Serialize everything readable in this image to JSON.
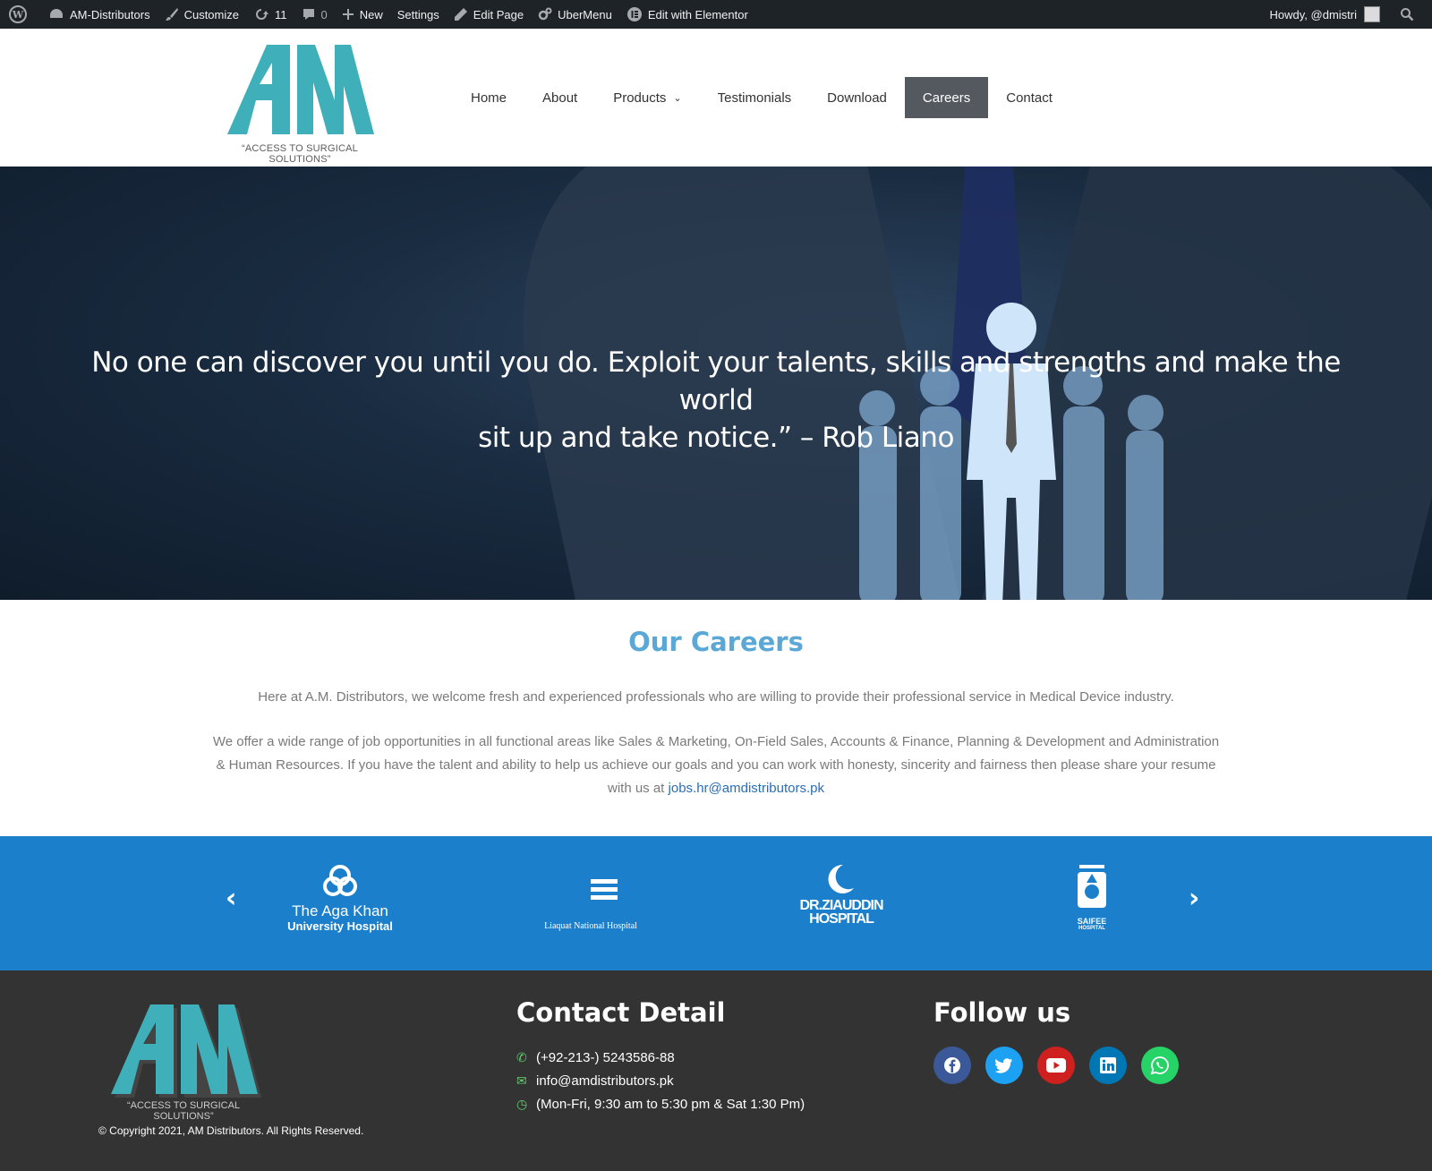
{
  "admin_bar": {
    "site_name": "AM-Distributors",
    "customize": "Customize",
    "updates_count": "11",
    "comments_count": "0",
    "new_label": "New",
    "settings": "Settings",
    "edit_page": "Edit Page",
    "ubermenu": "UberMenu",
    "edit_elementor": "Edit with Elementor",
    "howdy": "Howdy, @dmistri"
  },
  "header": {
    "logo_text": "AM",
    "logo_tagline": "“ACCESS TO SURGICAL SOLUTIONS”",
    "nav": [
      {
        "label": "Home"
      },
      {
        "label": "About"
      },
      {
        "label": "Products"
      },
      {
        "label": "Testimonials"
      },
      {
        "label": "Download"
      },
      {
        "label": "Careers"
      },
      {
        "label": "Contact"
      }
    ],
    "active_nav": "Careers"
  },
  "hero": {
    "quote_line1": "No one can discover you until you do. Exploit your talents, skills and strengths and make the world",
    "quote_line2": "sit up and take notice.” – Rob Liano"
  },
  "careers": {
    "title": "Our Careers",
    "paragraph1": "Here at A.M. Distributors, we welcome fresh and experienced professionals who are willing to provide their professional service in Medical Device industry.",
    "paragraph2": "We offer a wide range of job opportunities in all functional areas like Sales & Marketing, On-Field Sales, Accounts & Finance, Planning & Development and Administration & Human Resources. If you have the talent and ability to help us achieve our goals and you can work with honesty, sincerity and fairness then please share your resume with us at",
    "email": "jobs.hr@amdistributors.pk"
  },
  "partners": {
    "items": [
      {
        "line1": "The Aga Khan",
        "line2": "University Hospital"
      },
      {
        "line1": "Liaquat National Hospital"
      },
      {
        "line1": "DR.ZIAUDDIN",
        "line2": "HOSPITAL"
      },
      {
        "line1": "SAIFEE",
        "line2": "HOSPITAL"
      }
    ],
    "prev_icon": "chevron-left-icon",
    "next_icon": "chevron-right-icon"
  },
  "footer": {
    "logo_text": "AM",
    "logo_tagline": "“ACCESS TO SURGICAL SOLUTIONS”",
    "copyright": "© Copyright 2021, AM Distributors. All Rights Reserved.",
    "contact_title": "Contact Detail",
    "phone": "(+92-213-) 5243586-88",
    "email": "info@amdistributors.pk",
    "hours": "(Mon-Fri, 9:30 am to 5:30 pm & Sat 1:30 Pm)",
    "follow_title": "Follow us",
    "socials": [
      {
        "name": "facebook-icon",
        "color": "#3b5998"
      },
      {
        "name": "twitter-icon",
        "color": "#1da1f2"
      },
      {
        "name": "youtube-icon",
        "color": "#cd201f"
      },
      {
        "name": "linkedin-icon",
        "color": "#0077b5"
      },
      {
        "name": "whatsapp-icon",
        "color": "#25d366"
      }
    ]
  },
  "colors": {
    "brand_teal": "#3fb0b9",
    "careers_title": "#5ba8d7",
    "partners_bg": "#1b7fcc",
    "footer_bg": "#333333",
    "active_nav_bg": "#54595f",
    "contact_icon": "#61ce70"
  }
}
